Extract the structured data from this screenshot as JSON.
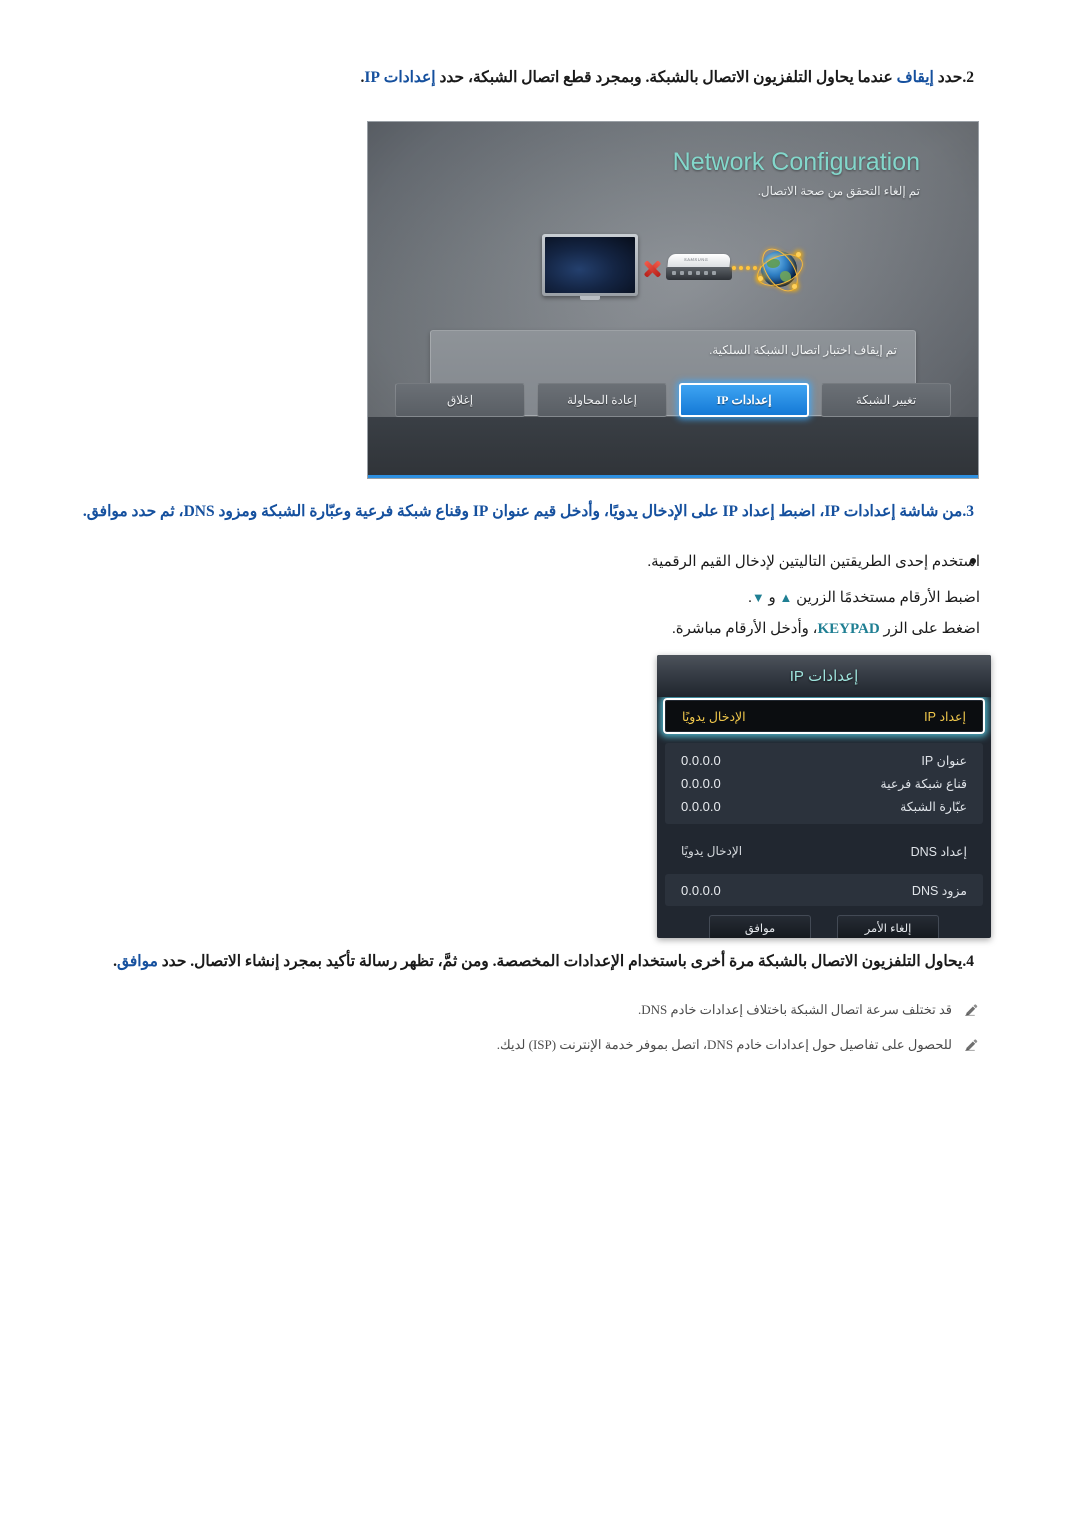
{
  "steps": {
    "step2": {
      "num": "2.",
      "parts": [
        {
          "t": "حدد ",
          "blue": false
        },
        {
          "t": "إيقاف",
          "blue": true
        },
        {
          "t": " عندما يحاول التلفزيون الاتصال بالشبكة. وبمجرد قطع اتصال الشبكة، حدد ",
          "blue": false
        },
        {
          "t": "إعدادات IP",
          "blue": true
        },
        {
          "t": ".",
          "blue": false
        }
      ]
    },
    "step3": {
      "num": "3.",
      "text": "من شاشة إعدادات IP، اضبط إعداد IP على الإدخال يدويًا، وأدخل قيم عنوان IP وقناع شبكة فرعية وعبّارة الشبكة ومزود DNS، ثم حدد موافق."
    },
    "step4": {
      "num": "4.",
      "parts": [
        {
          "t": "يحاول التلفزيون الاتصال بالشبكة مرة أخرى باستخدام الإعدادات المخصصة. ومن ثمَّ، تظهر رسالة تأكيد بمجرد إنشاء الاتصال. حدد ",
          "blue": false
        },
        {
          "t": "موافق",
          "blue": true
        },
        {
          "t": ".",
          "blue": false
        }
      ]
    }
  },
  "sub_items": {
    "bullet": "استخدم إحدى الطريقتين التاليتين لإدخال القيم الرقمية.",
    "line_up_down_pre": "اضبط الأرقام مستخدمًا الزرين ",
    "triangle_up": "▲",
    "and_word": " و ",
    "triangle_down": "▼",
    "line_up_down_post": ".",
    "line_keypad_pre": "اضغط على الزر ",
    "keypad_label": "KEYPAD",
    "line_keypad_post": "، وأدخل الأرقام مباشرة."
  },
  "notes": [
    {
      "icon": "pencil-icon",
      "text": "قد تختلف سرعة اتصال الشبكة باختلاف إعدادات خادم DNS."
    },
    {
      "icon": "pencil-icon",
      "text": "للحصول على تفاصيل حول إعدادات خادم DNS، اتصل بموفر خدمة الإنترنت (ISP) لديك."
    }
  ],
  "tv_screenshot": {
    "title": "Network Configuration",
    "subtitle": "تم إلغاء التحقق من صحة الاتصال.",
    "router_brand": "SAMSUNG",
    "message": "تم إيقاف اختبار اتصال الشبكة السلكية.",
    "buttons": [
      {
        "label": "تغيير الشبكة",
        "selected": false
      },
      {
        "label": "إعدادات IP",
        "selected": true
      },
      {
        "label": "إعادة المحاولة",
        "selected": false
      },
      {
        "label": "إغلاق",
        "selected": false
      }
    ],
    "colors": {
      "title": "#83d7cb",
      "accent": "#2d8fe0",
      "selected_button": "#1479d6"
    }
  },
  "ip_dialog": {
    "title": "إعدادات IP",
    "highlight_row": {
      "label": "إعداد IP",
      "value": "الإدخال يدويًا"
    },
    "address_rows": [
      {
        "label": "عنوان IP",
        "value": "0.0.0.0"
      },
      {
        "label": "قناع شبكة فرعية",
        "value": "0.0.0.0"
      },
      {
        "label": "عبّارة الشبكة",
        "value": "0.0.0.0"
      }
    ],
    "dns_setup_row": {
      "label": "إعداد DNS",
      "value": "الإدخال يدويًا"
    },
    "dns_server_row": {
      "label": "مزود DNS",
      "value": "0.0.0.0"
    },
    "buttons": [
      {
        "label": "إلغاء الأمر"
      },
      {
        "label": "موافق"
      }
    ],
    "colors": {
      "title": "#9fe4dd",
      "highlight_text": "#f2c94c",
      "highlight_glow": "#5ad7f0"
    }
  }
}
